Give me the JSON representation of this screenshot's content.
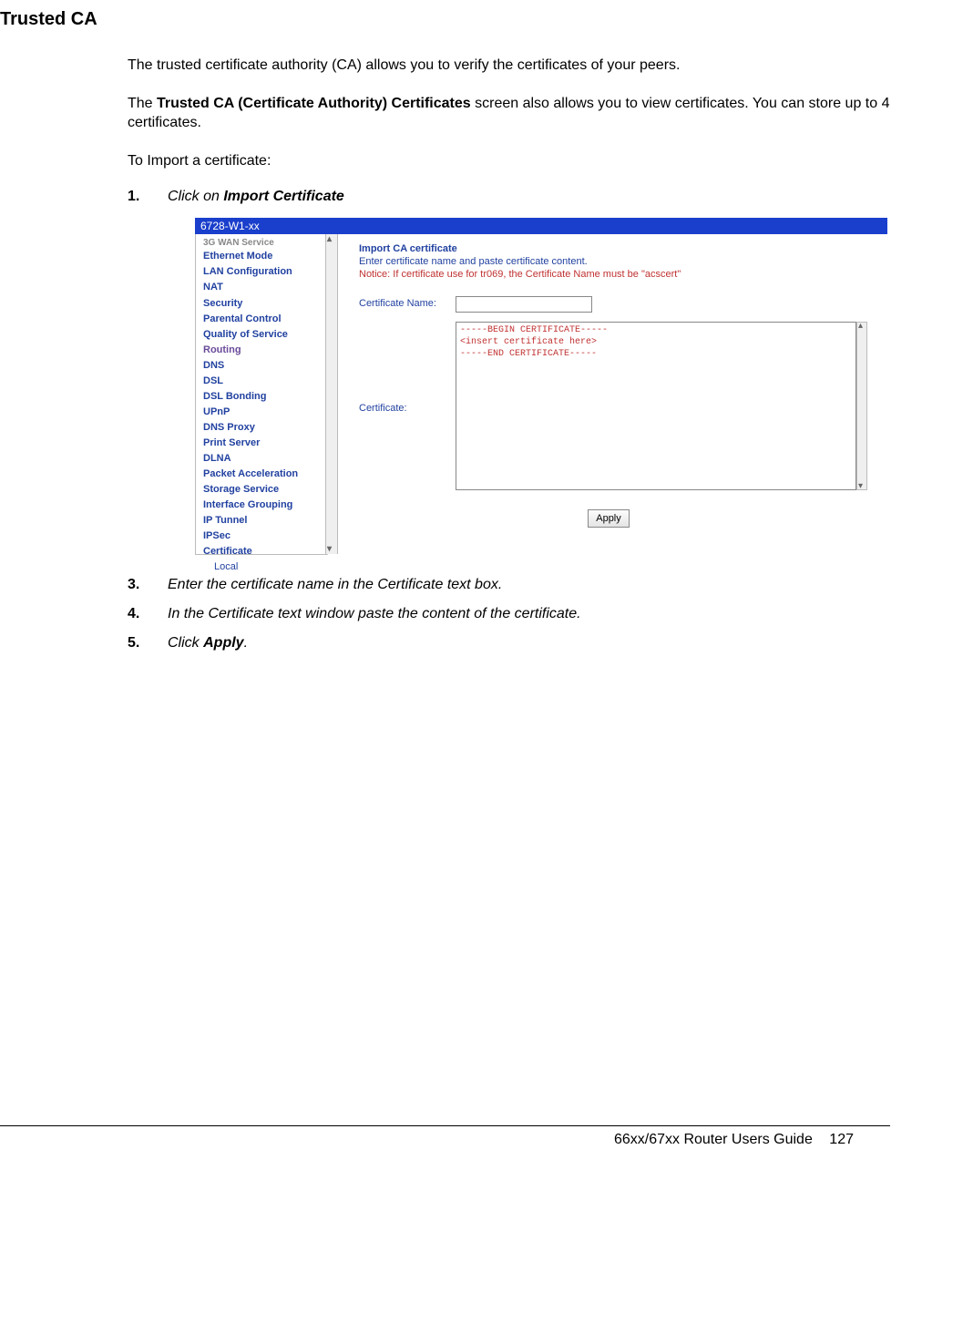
{
  "title": "Trusted CA",
  "intro1": "The trusted certificate authority (CA) allows you to verify the certificates of your peers.",
  "intro2_pre": "The ",
  "intro2_bold": "Trusted CA (Certificate Authority) Certificates",
  "intro2_post": " screen also allows you to view certificates. You can store up to 4 certificates.",
  "intro3": "To Import a certificate:",
  "steps": {
    "s1_num": "1.",
    "s1_pre": "Click on ",
    "s1_bold": "Import Certificate",
    "s3_num": "3.",
    "s3_text": "Enter the certificate name in the Certificate text box.",
    "s4_num": "4.",
    "s4_text": "In the Certificate text window paste the content of the certificate.",
    "s5_num": "5.",
    "s5_pre": "Click ",
    "s5_bold": "Apply",
    "s5_post": "."
  },
  "shot": {
    "titlebar": "6728-W1-xx",
    "sidebar": [
      "3G WAN Service",
      "Ethernet Mode",
      "LAN Configuration",
      "NAT",
      "Security",
      "Parental Control",
      "Quality of Service",
      "Routing",
      "DNS",
      "DSL",
      "DSL Bonding",
      "UPnP",
      "DNS Proxy",
      "Print Server",
      "DLNA",
      "Packet Acceleration",
      "Storage Service",
      "Interface Grouping",
      "IP Tunnel",
      "IPSec",
      "Certificate",
      "Local"
    ],
    "main": {
      "heading": "Import CA certificate",
      "desc": "Enter certificate name and paste certificate content.",
      "notice": "Notice: If certificate use for tr069, the Certificate Name must be \"acscert\"",
      "cert_name_label": "Certificate Name:",
      "cert_label": "Certificate:",
      "cert_placeholder": "-----BEGIN CERTIFICATE-----\n<insert certificate here>\n-----END CERTIFICATE-----",
      "apply_label": "Apply"
    }
  },
  "footer": {
    "guide": "66xx/67xx Router Users Guide",
    "page": "127"
  }
}
